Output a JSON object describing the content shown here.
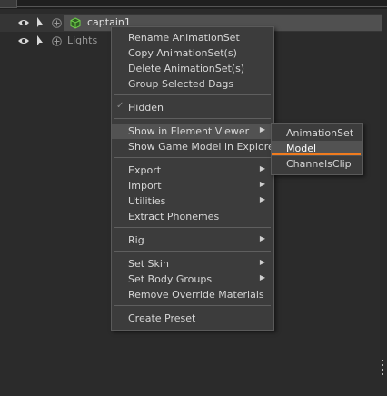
{
  "outliner": {
    "rows": [
      {
        "label": "captain1",
        "icons": [
          "eye-icon",
          "pointer-arrow-icon",
          "expand-plus-icon",
          "cube-icon"
        ]
      },
      {
        "label": "Lights",
        "icons": [
          "eye-icon",
          "pointer-arrow-icon",
          "expand-plus-icon"
        ]
      }
    ]
  },
  "context_menu": {
    "items": [
      {
        "label": "Rename AnimationSet"
      },
      {
        "label": "Copy AnimationSet(s)"
      },
      {
        "label": "Delete AnimationSet(s)"
      },
      {
        "label": "Group Selected Dags"
      },
      {
        "label": "Hidden",
        "checked": true
      },
      {
        "label": "Show in Element Viewer",
        "submenu": true,
        "highlighted": true
      },
      {
        "label": "Show Game Model in Explorer"
      },
      {
        "label": "Export",
        "submenu": true
      },
      {
        "label": "Import",
        "submenu": true
      },
      {
        "label": "Utilities",
        "submenu": true
      },
      {
        "label": "Extract Phonemes"
      },
      {
        "label": "Rig",
        "submenu": true
      },
      {
        "label": "Set Skin",
        "submenu": true
      },
      {
        "label": "Set Body Groups",
        "submenu": true
      },
      {
        "label": "Remove Override Materials"
      },
      {
        "label": "Create Preset"
      }
    ],
    "check_glyph": "✓",
    "submenu_glyph": "▶"
  },
  "submenu": {
    "items": [
      {
        "label": "AnimationSet"
      },
      {
        "label": "Model",
        "highlighted": true
      },
      {
        "label": "ChannelsClip"
      }
    ]
  },
  "colors": {
    "background": "#2b2b2b",
    "menu_bg": "#3c3c3c",
    "highlight": "#525252",
    "accent_orange": "#f07b1e",
    "cube_green": "#6fcf4a"
  }
}
